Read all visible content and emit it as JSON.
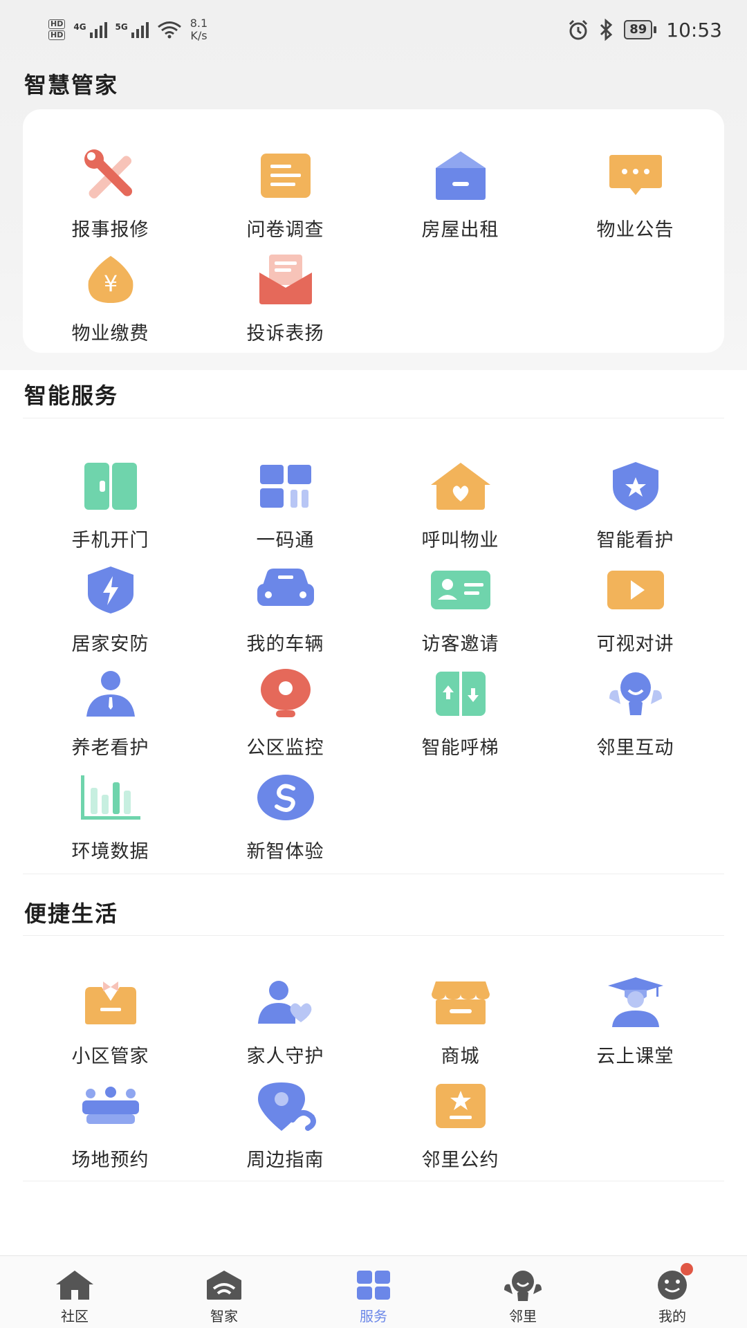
{
  "status_bar": {
    "hd1": "HD",
    "hd2": "HD",
    "sig1_label": "4G",
    "sig2_label": "5G",
    "speed_value": "8.1",
    "speed_unit": "K/s",
    "battery": "89",
    "time": "10:53"
  },
  "sections": {
    "butler": {
      "title": "智慧管家",
      "items": [
        {
          "label": "报事报修",
          "icon": "wrench-icon"
        },
        {
          "label": "问卷调查",
          "icon": "survey-icon"
        },
        {
          "label": "房屋出租",
          "icon": "house-rent-icon"
        },
        {
          "label": "物业公告",
          "icon": "announcement-icon"
        },
        {
          "label": "物业缴费",
          "icon": "payment-icon"
        },
        {
          "label": "投诉表扬",
          "icon": "complaint-icon"
        }
      ]
    },
    "smart": {
      "title": "智能服务",
      "items": [
        {
          "label": "手机开门",
          "icon": "door-icon"
        },
        {
          "label": "一码通",
          "icon": "qr-grid-icon"
        },
        {
          "label": "呼叫物业",
          "icon": "call-property-icon"
        },
        {
          "label": "智能看护",
          "icon": "shield-star-icon"
        },
        {
          "label": "居家安防",
          "icon": "security-icon"
        },
        {
          "label": "我的车辆",
          "icon": "car-icon"
        },
        {
          "label": "访客邀请",
          "icon": "visitor-card-icon"
        },
        {
          "label": "可视对讲",
          "icon": "video-intercom-icon"
        },
        {
          "label": "养老看护",
          "icon": "elder-care-icon"
        },
        {
          "label": "公区监控",
          "icon": "camera-icon"
        },
        {
          "label": "智能呼梯",
          "icon": "elevator-icon"
        },
        {
          "label": "邻里互动",
          "icon": "neighbor-icon"
        },
        {
          "label": "环境数据",
          "icon": "chart-icon"
        },
        {
          "label": "新智体验",
          "icon": "experience-icon"
        }
      ]
    },
    "life": {
      "title": "便捷生活",
      "items": [
        {
          "label": "小区管家",
          "icon": "butler-icon"
        },
        {
          "label": "家人守护",
          "icon": "family-guard-icon"
        },
        {
          "label": "商城",
          "icon": "store-icon"
        },
        {
          "label": "云上课堂",
          "icon": "graduation-icon"
        },
        {
          "label": "场地预约",
          "icon": "venue-icon"
        },
        {
          "label": "周边指南",
          "icon": "map-pin-icon"
        },
        {
          "label": "邻里公约",
          "icon": "convention-icon"
        }
      ]
    }
  },
  "bottom_nav": [
    {
      "label": "社区",
      "icon": "home-icon",
      "active": false
    },
    {
      "label": "智家",
      "icon": "smart-home-icon",
      "active": false
    },
    {
      "label": "服务",
      "icon": "grid-icon",
      "active": true
    },
    {
      "label": "邻里",
      "icon": "neighbor-nav-icon",
      "active": false
    },
    {
      "label": "我的",
      "icon": "profile-icon",
      "active": false
    }
  ],
  "colors": {
    "accent": "#6b87e8",
    "orange": "#f2b35a",
    "red": "#e5695a",
    "green": "#6fd4ac",
    "badge": "#e05745"
  }
}
